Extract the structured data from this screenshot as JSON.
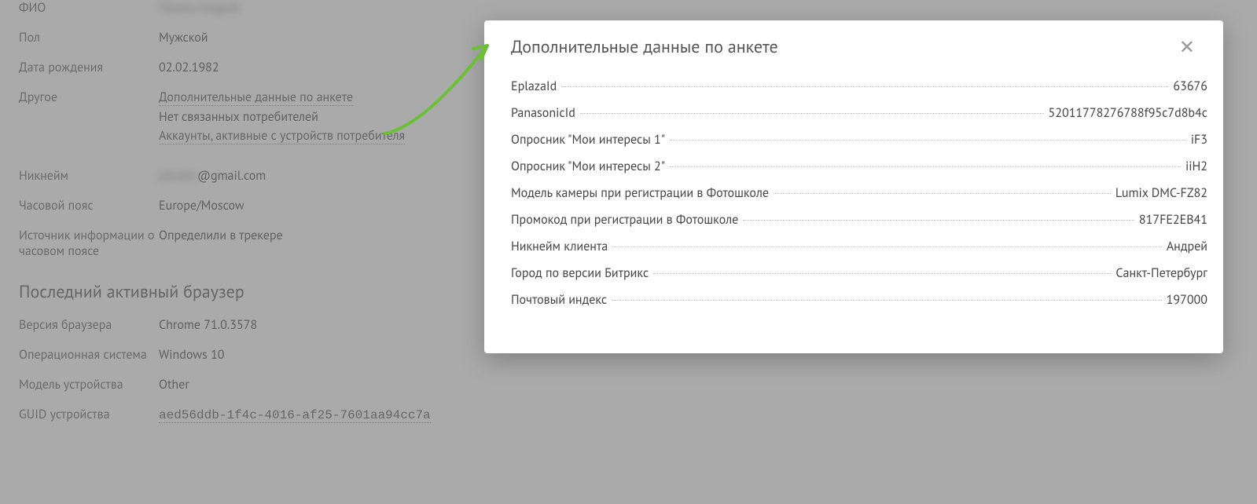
{
  "profile": {
    "fields": [
      {
        "label": "ФИО",
        "value": "Пашин Андрей",
        "blurred": true
      },
      {
        "label": "Пол",
        "value": "Мужской"
      },
      {
        "label": "Дата рождения",
        "value": "02.02.1982"
      }
    ],
    "other_label": "Другое",
    "other": {
      "link1": "Дополнительные данные по анкете",
      "text1": "Нет связанных потребителей",
      "link2": "Аккаунты, активные с устройств потребителя"
    },
    "fields2": [
      {
        "label": "Никнейм",
        "value_prefix_blurred": "pAndre",
        "value_suffix": "@gmail.com"
      },
      {
        "label": "Часовой пояс",
        "value": "Europe/Moscow"
      },
      {
        "label": "Источник информации о часовом поясе",
        "value": "Определили в трекере"
      }
    ],
    "browser_section_title": "Последний активный браузер",
    "browser_fields": [
      {
        "label": "Версия браузера",
        "value": "Chrome 71.0.3578"
      },
      {
        "label": "Операционная система",
        "value": "Windows 10"
      },
      {
        "label": "Модель устройства",
        "value": "Other"
      },
      {
        "label": "GUID устройства",
        "value": "aed56ddb-1f4c-4016-af25-7601aa94cc7a",
        "mono": true,
        "link": true
      }
    ]
  },
  "modal": {
    "title": "Дополнительные данные по анкете",
    "rows": [
      {
        "key": "EplazaId",
        "value": "63676"
      },
      {
        "key": "PanasonicId",
        "value": "52011778276788f95c7d8b4c"
      },
      {
        "key": "Опросник \"Мои интересы 1\"",
        "value": "iF3"
      },
      {
        "key": "Опросник \"Мои интересы 2\"",
        "value": "iiH2"
      },
      {
        "key": "Модель камеры при регистрации в Фотошколе",
        "value": "Lumix DMC-FZ82"
      },
      {
        "key": "Промокод при регистрации в Фотошколе",
        "value": "817FE2EB41"
      },
      {
        "key": "Никнейм клиента",
        "value": "Андрей"
      },
      {
        "key": "Город по версии Битрикс",
        "value": "Санкт-Петербург"
      },
      {
        "key": "Почтовый индекс",
        "value": "197000"
      }
    ]
  }
}
